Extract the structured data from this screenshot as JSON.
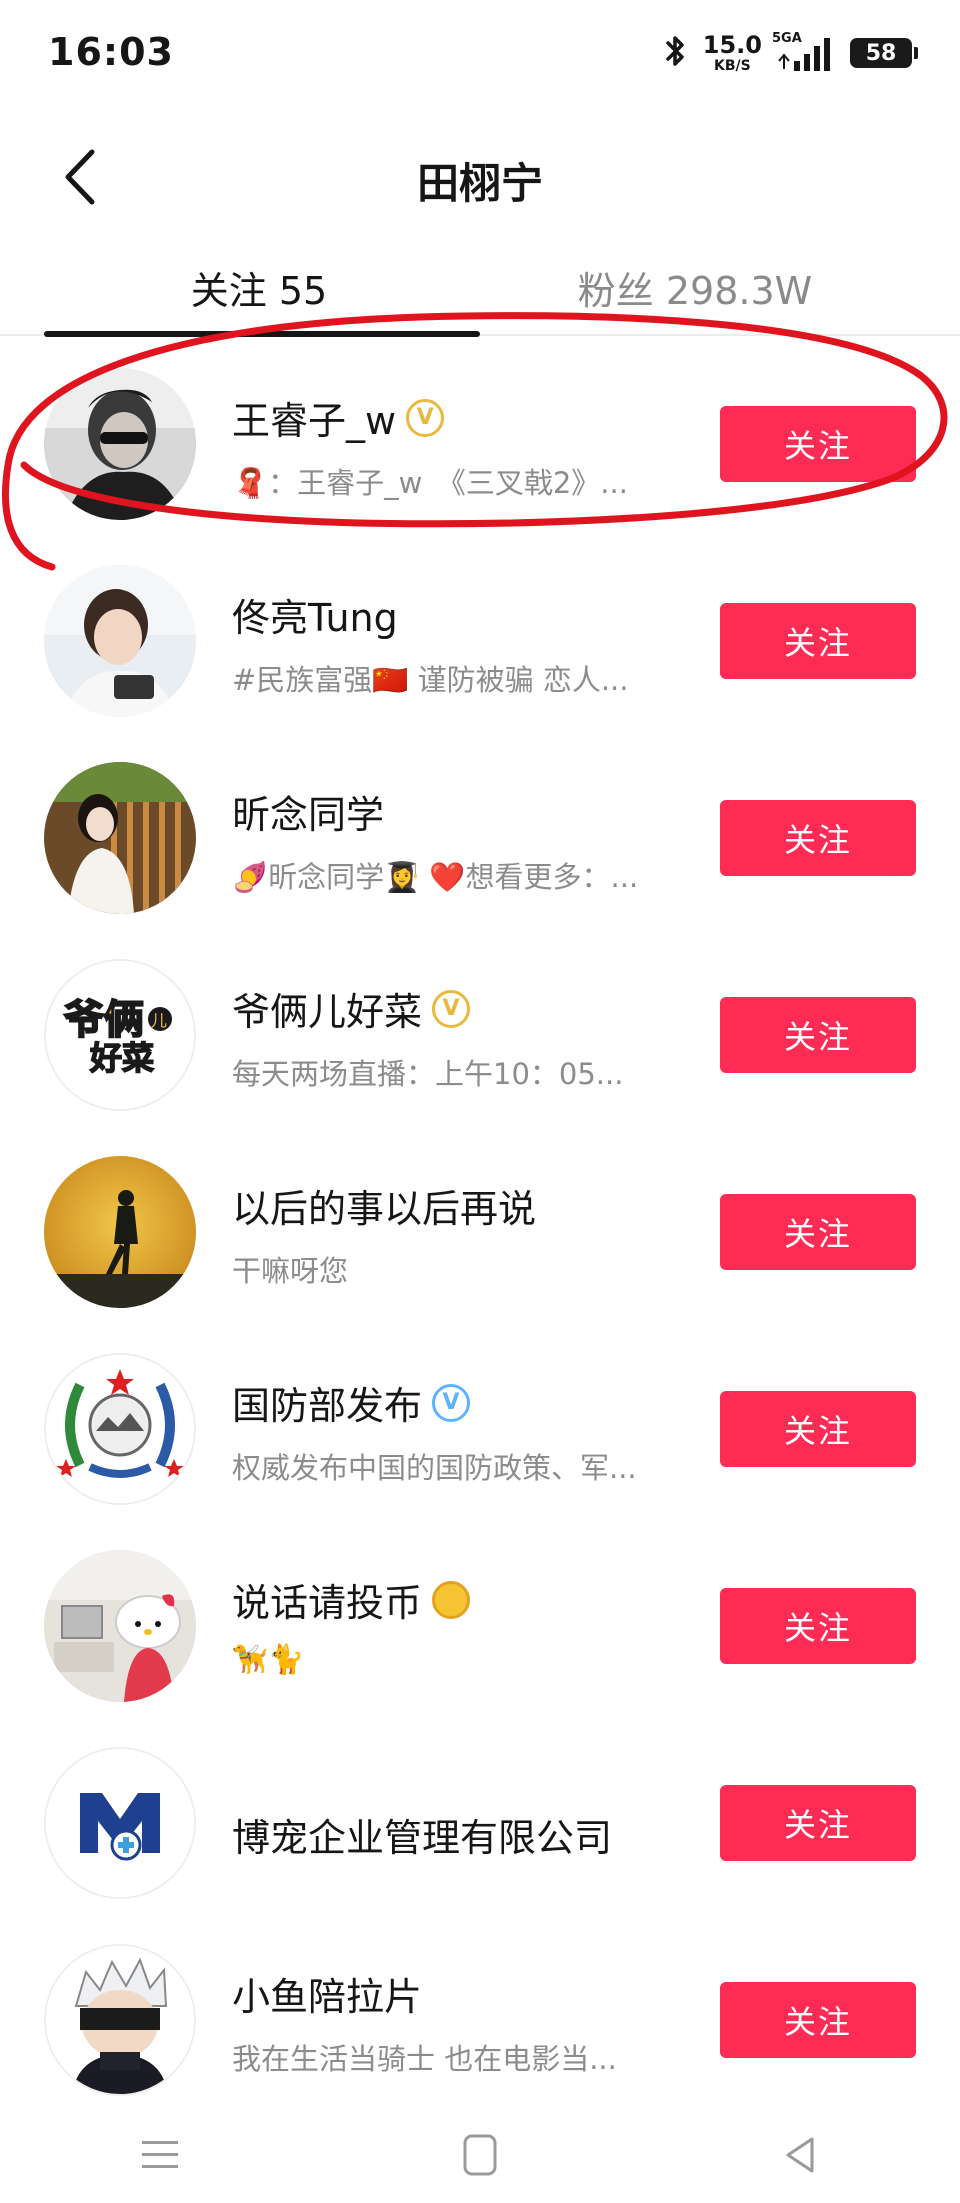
{
  "status_bar": {
    "time": "16:03",
    "net_speed_value": "15.0",
    "net_speed_unit": "KB/S",
    "signal_label": "5GA",
    "battery": "58"
  },
  "header": {
    "title": "田栩宁",
    "back_icon": "chevron-left-icon"
  },
  "tabs": [
    {
      "label": "关注 55",
      "active": true
    },
    {
      "label": "粉丝 298.3W",
      "active": false
    }
  ],
  "follow_list": [
    {
      "name": "王睿子_w",
      "badge": "gold-v",
      "desc_icon": "scarf-emoji",
      "desc": "：王睿子_w　《三叉戟2》...",
      "button": "关注",
      "highlighted": true
    },
    {
      "name": "佟亮Tung",
      "badge": "",
      "desc": "#民族富强🇨🇳 谨防被骗 恋人...",
      "button": "关注"
    },
    {
      "name": "昕念同学",
      "badge": "",
      "desc": "🍠昕念同学👩‍🎓 ❤️想看更多：...",
      "button": "关注"
    },
    {
      "name": "爷俩儿好菜",
      "badge": "gold-v",
      "desc": "每天两场直播：上午10：05...",
      "button": "关注"
    },
    {
      "name": "以后的事以后再说",
      "badge": "",
      "desc": "干嘛呀您",
      "button": "关注"
    },
    {
      "name": "国防部发布",
      "badge": "blue-v",
      "desc": "权威发布中国的国防政策、军...",
      "button": "关注"
    },
    {
      "name": "说话请投币",
      "badge": "coin",
      "desc": "🦮🐈",
      "button": "关注"
    },
    {
      "name": "博宠企业管理有限公司",
      "badge": "",
      "desc": "",
      "button": "关注"
    },
    {
      "name": "小鱼陪拉片",
      "badge": "",
      "desc": "我在生活当骑士 也在电影当...",
      "button": "关注"
    }
  ],
  "avatar_texts": {
    "yeliaer_top": "爷俩",
    "yeliaer_er": "儿",
    "yeliaer_bottom": "好菜"
  },
  "nav_bar": {
    "menu_icon": "menu-icon",
    "home_icon": "home-square-icon",
    "back_icon": "back-triangle-icon"
  },
  "colors": {
    "follow_button": "#fe2c55",
    "annotation": "#e0141e",
    "secondary_text": "#8c8c8c"
  }
}
